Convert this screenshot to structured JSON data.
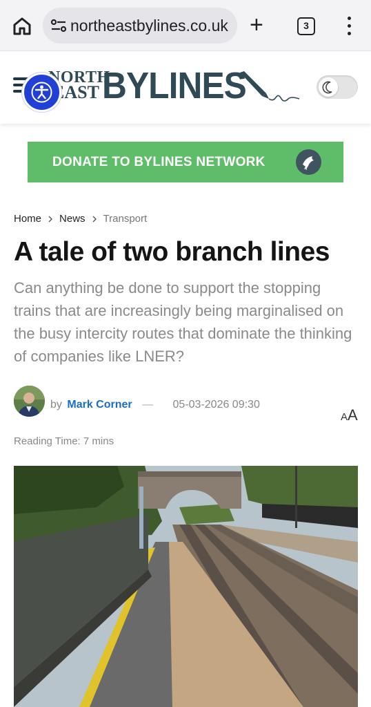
{
  "browser": {
    "url": "northeastbylines.co.uk",
    "tab_count": "3"
  },
  "site": {
    "logo_north": "NORTH",
    "logo_east": "EAST",
    "logo_bylines": "BYLINES"
  },
  "donate": {
    "label": "DONATE TO BYLINES NETWORK"
  },
  "breadcrumb": {
    "items": [
      "Home",
      "News",
      "Transport"
    ]
  },
  "article": {
    "title": "A tale of two branch lines",
    "standfirst": "Can anything be done to support the stopping trains that are increasingly being marginalised on the busy intercity routes that dominate the thinking of companies like LNER?",
    "by_prefix": "by",
    "author": "Mark Corner",
    "separator": "—",
    "date": "05-03-2026 09:30",
    "font_toggle_small": "A",
    "font_toggle_large": "A",
    "reading_time": "Reading Time: 7 mins"
  },
  "colors": {
    "donate_bg": "#5fbd6a",
    "logo_text": "#2f4a55",
    "accessibility_button": "#2140d6",
    "author_link": "#1a6ec0"
  }
}
